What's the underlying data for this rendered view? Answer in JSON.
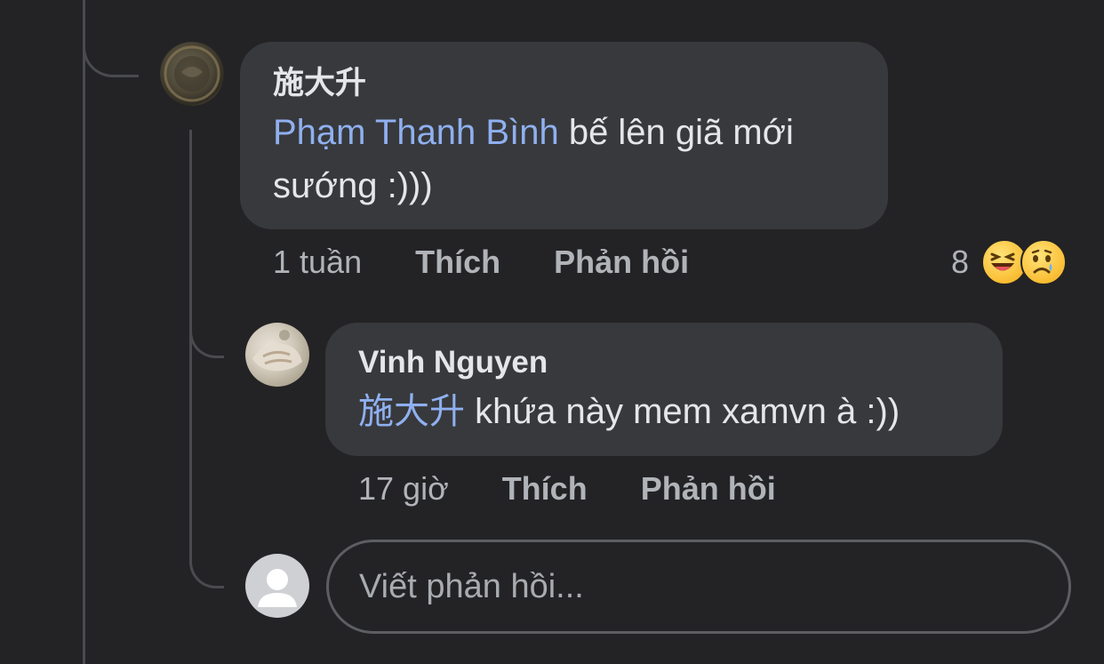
{
  "comments": [
    {
      "author": "施大升",
      "mention": "Phạm Thanh Bình",
      "text_line1": " bế lên giã mới",
      "text_line2": "sướng :)))",
      "time": "1 tuần",
      "like_label": "Thích",
      "reply_label": "Phản hồi",
      "reaction_count": "8",
      "reactions": [
        "laughing-emoji",
        "sad-emoji"
      ]
    },
    {
      "author": "Vinh Nguyen",
      "mention": "施大升",
      "text": " khứa này mem xamvn à :))",
      "time": "17 giờ",
      "like_label": "Thích",
      "reply_label": "Phản hồi"
    }
  ],
  "reply_box": {
    "placeholder": "Viết phản hồi..."
  },
  "colors": {
    "background": "#232325",
    "bubble": "#38393c",
    "mention": "#8fb0f0",
    "meta_text": "#b0b3b8"
  }
}
